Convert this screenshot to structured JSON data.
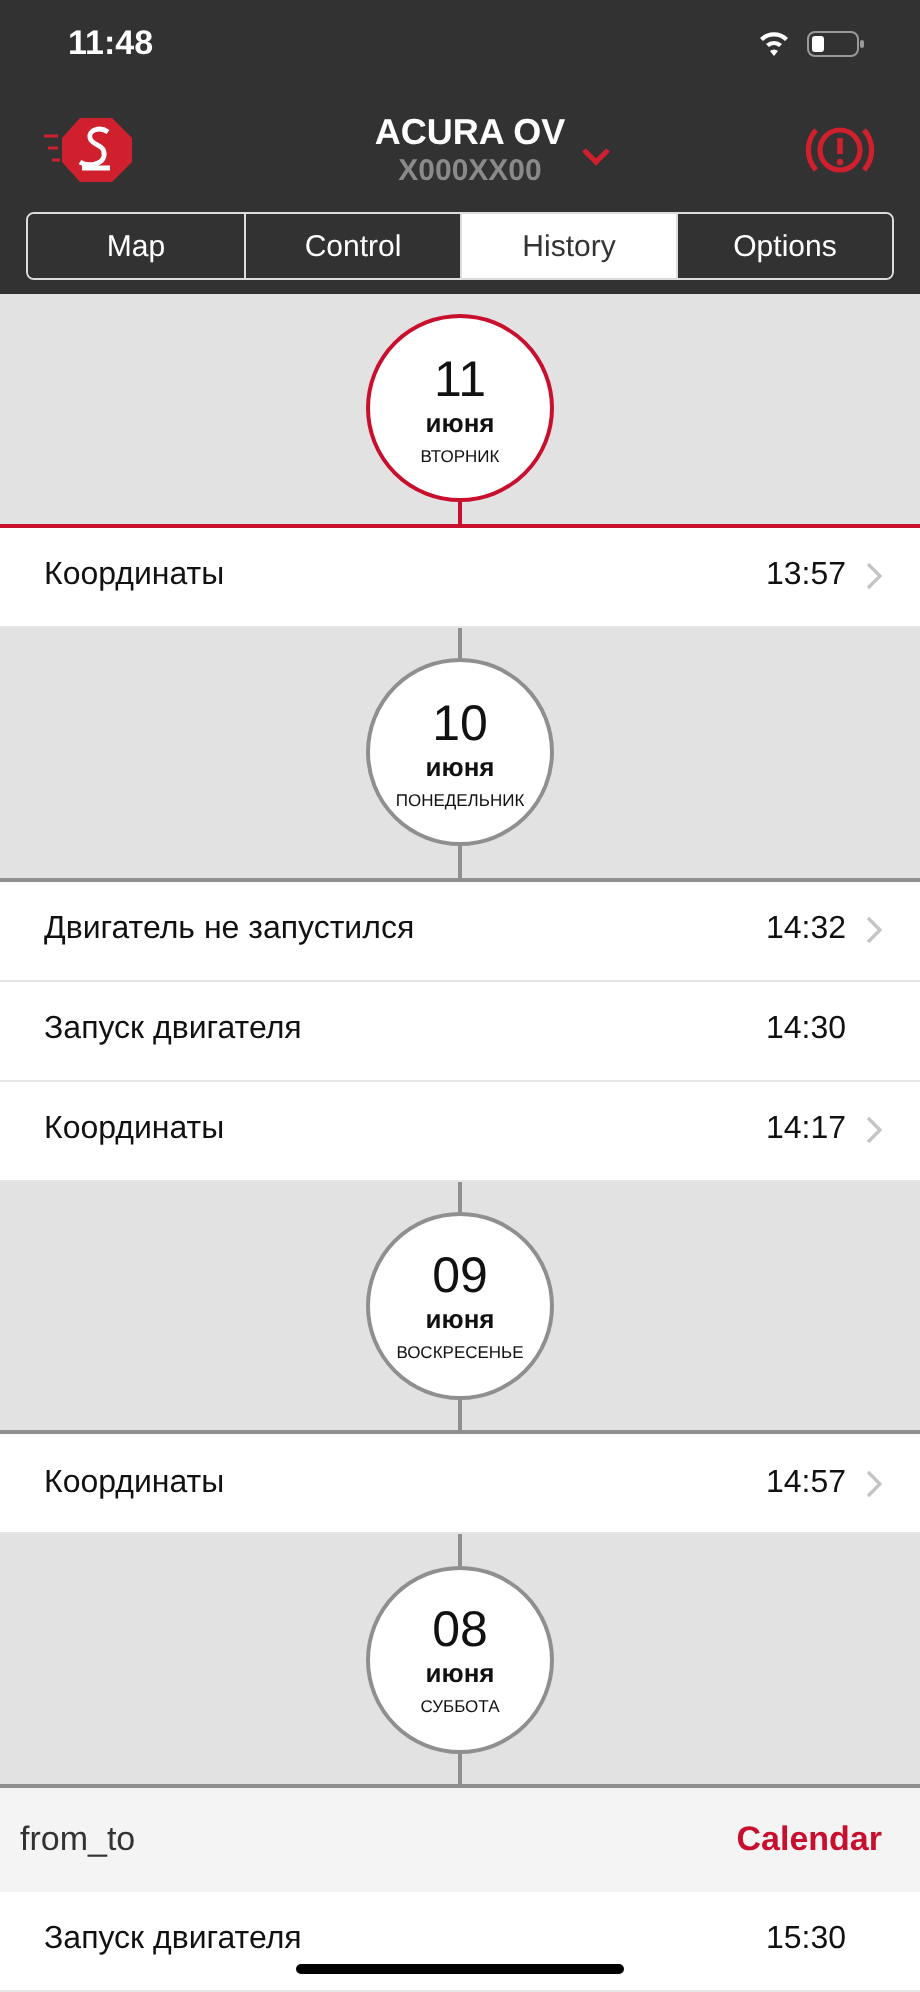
{
  "status_bar": {
    "time": "11:48"
  },
  "header": {
    "title": "ACURA OV",
    "subtitle": "X000XX00"
  },
  "tabs": [
    {
      "label": "Map",
      "selected": false
    },
    {
      "label": "Control",
      "selected": false
    },
    {
      "label": "History",
      "selected": true
    },
    {
      "label": "Options",
      "selected": false
    }
  ],
  "days": [
    {
      "day": "11",
      "month": "июня",
      "weekday": "ВТОРНИК",
      "selected": true,
      "events": [
        {
          "name": "Координаты",
          "time": "13:57",
          "has_details": true
        }
      ]
    },
    {
      "day": "10",
      "month": "июня",
      "weekday": "ПОНЕДЕЛЬНИК",
      "selected": false,
      "events": [
        {
          "name": "Двигатель не запустился",
          "time": "14:32",
          "has_details": true
        },
        {
          "name": "Запуск двигателя",
          "time": "14:30",
          "has_details": false
        },
        {
          "name": "Координаты",
          "time": "14:17",
          "has_details": true
        }
      ]
    },
    {
      "day": "09",
      "month": "июня",
      "weekday": "ВОСКРЕСЕНЬЕ",
      "selected": false,
      "events": [
        {
          "name": "Координаты",
          "time": "14:57",
          "has_details": true
        }
      ]
    },
    {
      "day": "08",
      "month": "июня",
      "weekday": "СУББОТА",
      "selected": false
    }
  ],
  "toolbar": {
    "left": "from_to",
    "right": "Calendar"
  },
  "after_toolbar": [
    {
      "name": "Запуск двигателя",
      "time": "15:30",
      "has_details": false
    }
  ]
}
